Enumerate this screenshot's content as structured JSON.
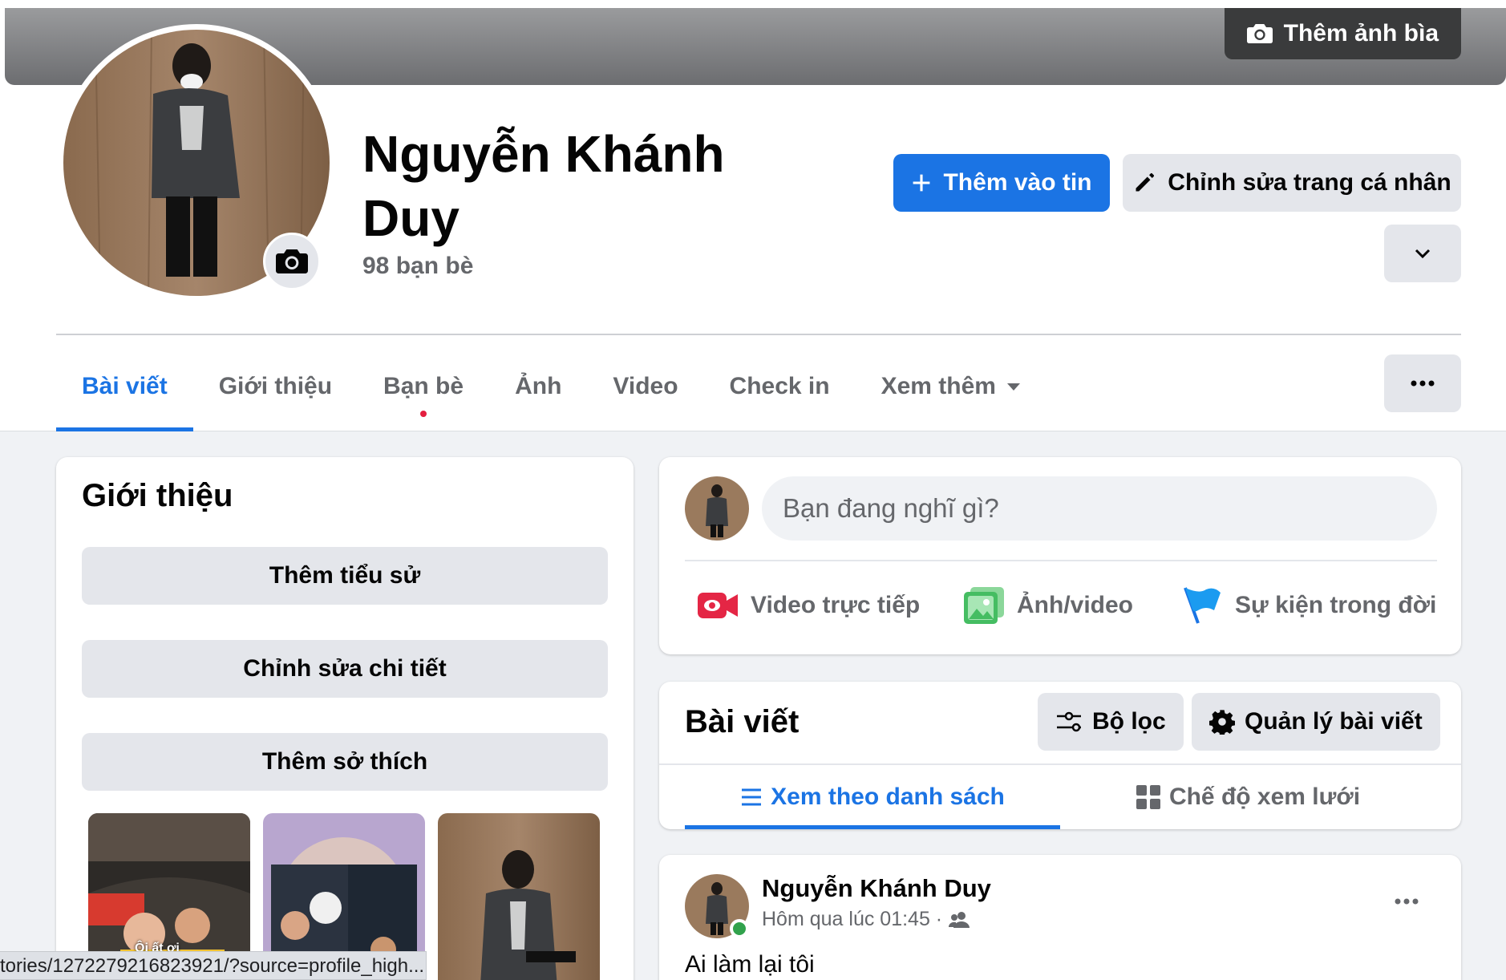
{
  "cover": {
    "add_cover_label": "Thêm ảnh bìa"
  },
  "profile": {
    "name": "Nguyễn Khánh Duy",
    "friends_count": "98 bạn bè",
    "add_story_label": "Thêm vào tin",
    "edit_profile_label": "Chỉnh sửa trang cá nhân"
  },
  "tabs": [
    {
      "label": "Bài viết",
      "active": true
    },
    {
      "label": "Giới thiệu"
    },
    {
      "label": "Bạn bè"
    },
    {
      "label": "Ảnh"
    },
    {
      "label": "Video"
    },
    {
      "label": "Check in"
    },
    {
      "label": "Xem thêm"
    }
  ],
  "intro": {
    "title": "Giới thiệu",
    "add_bio_label": "Thêm tiểu sử",
    "edit_details_label": "Chỉnh sửa chi tiết",
    "add_hobbies_label": "Thêm sở thích",
    "story_caption": "Ôi ất ơi"
  },
  "composer": {
    "placeholder": "Bạn đang nghĩ gì?",
    "live_video_label": "Video trực tiếp",
    "photo_video_label": "Ảnh/video",
    "life_event_label": "Sự kiện trong đời"
  },
  "posts_section": {
    "title": "Bài viết",
    "filter_label": "Bộ lọc",
    "manage_label": "Quản lý bài viết",
    "list_view_label": "Xem theo danh sách",
    "grid_view_label": "Chế độ xem lưới"
  },
  "post": {
    "author": "Nguyễn Khánh Duy",
    "time": "Hôm qua lúc 01:45 ·",
    "text": "Ai làm lại tôi"
  },
  "status_url": "tories/1272279216823921/?source=profile_high...",
  "colors": {
    "accent": "#1b74e4",
    "secondary_button": "#e4e6eb",
    "muted_text": "#65676b",
    "online": "#31a24c",
    "notification_dot": "#e41e3f"
  }
}
